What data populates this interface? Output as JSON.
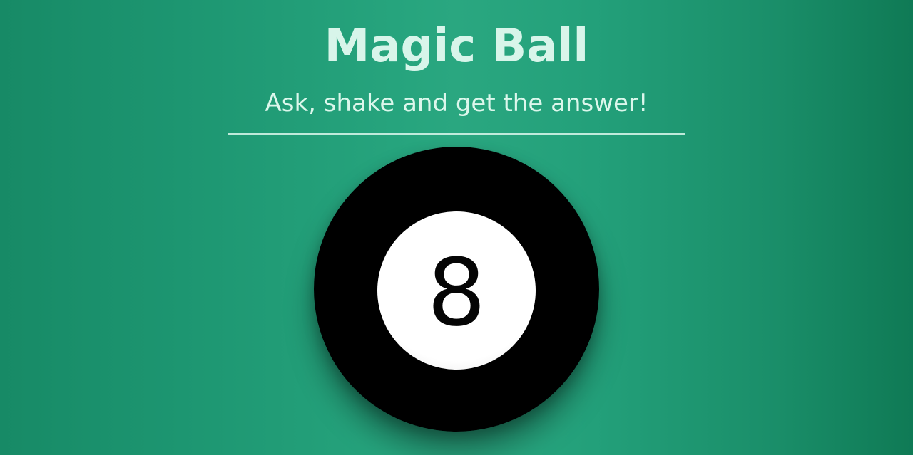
{
  "header": {
    "title": "Magic Ball",
    "subtitle": "Ask, shake and get the answer!"
  },
  "ball": {
    "number": "8"
  },
  "colors": {
    "background": "#1d9671",
    "title": "#d8f5ea",
    "ball": "#000000",
    "window": "#ffffff"
  }
}
